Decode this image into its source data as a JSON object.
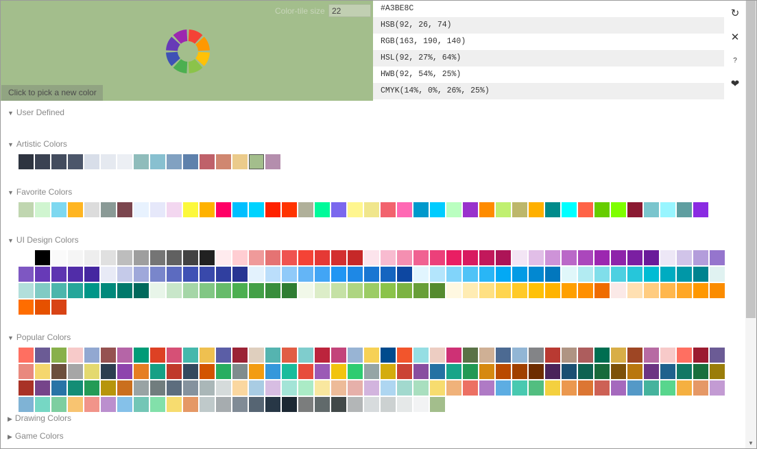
{
  "current_color": "#A3BE8C",
  "preview": {
    "tile_size_label": "Color-tile size",
    "tile_size_value": "22",
    "pick_button": "Click to pick a new color",
    "wheel_colors": [
      "#f44336",
      "#ff9800",
      "#ffc107",
      "#8bc34a",
      "#4caf50",
      "#3f51b5",
      "#673ab7",
      "#9c27b0"
    ]
  },
  "formats": [
    "#A3BE8C",
    "HSB(92, 26, 74)",
    "RGB(163, 190, 140)",
    "HSL(92, 27%, 64%)",
    "HWB(92, 54%, 25%)",
    "CMYK(14%, 0%, 26%, 25%)"
  ],
  "tools": [
    {
      "name": "refresh-icon",
      "glyph": "↻"
    },
    {
      "name": "close-icon",
      "glyph": "✕"
    },
    {
      "name": "help-icon",
      "glyph": "?"
    },
    {
      "name": "heart-icon",
      "glyph": "❤"
    }
  ],
  "sections": [
    {
      "id": "user-defined",
      "title": "User Defined",
      "expanded": true,
      "colors": []
    },
    {
      "id": "artistic",
      "title": "Artistic Colors",
      "expanded": true,
      "selected_index": 14,
      "colors": [
        "#2E3440",
        "#3B4252",
        "#434C5E",
        "#4C566A",
        "#D8DEE9",
        "#E5E9F0",
        "#ECEFF4",
        "#8FBCBB",
        "#88C0D0",
        "#81A1C1",
        "#5E81AC",
        "#BF616A",
        "#D08770",
        "#EBCB8B",
        "#A3BE8C",
        "#B48EAD"
      ]
    },
    {
      "id": "favorite",
      "title": "Favorite Colors",
      "expanded": true,
      "colors": [
        "#C0D6B0",
        "#D0F5D0",
        "#7ED8F0",
        "#FFB521",
        "#DCDCDC",
        "#8A9A96",
        "#7B464E",
        "#E8F2FE",
        "#E6E8FA",
        "#F3D7F0",
        "#FCF83C",
        "#FFB200",
        "#FF0066",
        "#00BFFF",
        "#00D3FF",
        "#FF2200",
        "#FF3300",
        "#B0B09A",
        "#00FA9A",
        "#7B68EE",
        "#FFF68F",
        "#F0E68C",
        "#F2636E",
        "#FF69B4",
        "#0099CC",
        "#00CCFF",
        "#BAFFC0",
        "#9932CC",
        "#FF8C00",
        "#C0F070",
        "#BDB76B",
        "#FFB000",
        "#008B8B",
        "#00FFFF",
        "#FF6347",
        "#66CD00",
        "#7FFF00",
        "#8B1A32",
        "#7AC5CD",
        "#98F5FF",
        "#5F9EA0",
        "#8A2BE2"
      ]
    },
    {
      "id": "ui-design",
      "title": "UI Design Colors",
      "expanded": true,
      "colors": [
        "#FFFFFF",
        "#000000",
        "#FAFAFA",
        "#F5F5F5",
        "#EEEEEE",
        "#E0E0E0",
        "#BDBDBD",
        "#9E9E9E",
        "#757575",
        "#616161",
        "#424242",
        "#212121",
        "#FFEBEE",
        "#FFCDD2",
        "#EF9A9A",
        "#E57373",
        "#EF5350",
        "#F44336",
        "#E53935",
        "#D32F2F",
        "#C62828",
        "#FCE4EC",
        "#F8BBD0",
        "#F48FB1",
        "#F06292",
        "#EC407A",
        "#E91E63",
        "#D81B60",
        "#C2185B",
        "#AD1457",
        "#F3E5F5",
        "#E1BEE7",
        "#CE93D8",
        "#BA68C8",
        "#AB47BC",
        "#9C27B0",
        "#8E24AA",
        "#7B1FA2",
        "#6A1B9A",
        "#EDE7F6",
        "#D1C4E9",
        "#B39DDB",
        "#9575CD",
        "#7E57C2",
        "#673AB7",
        "#5E35B1",
        "#512DA8",
        "#4527A0",
        "#E8EAF6",
        "#C5CAE9",
        "#9FA8DA",
        "#7986CB",
        "#5C6BC0",
        "#3F51B5",
        "#3949AB",
        "#303F9F",
        "#283593",
        "#E3F2FD",
        "#BBDEFB",
        "#90CAF9",
        "#64B5F6",
        "#42A5F5",
        "#2196F3",
        "#1E88E5",
        "#1976D2",
        "#1565C0",
        "#0D47A1",
        "#E1F5FE",
        "#B3E5FC",
        "#81D4FA",
        "#4FC3F7",
        "#29B6F6",
        "#03A9F4",
        "#039BE5",
        "#0288D1",
        "#0277BD",
        "#E0F7FA",
        "#B2EBF2",
        "#80DEEA",
        "#4DD0E1",
        "#26C6DA",
        "#00BCD4",
        "#00ACC1",
        "#0097A7",
        "#00838F",
        "#E0F2F1",
        "#B2DFDB",
        "#80CBC4",
        "#4DB6AC",
        "#26A69A",
        "#009688",
        "#00897B",
        "#00796B",
        "#00695C",
        "#E8F5E9",
        "#C8E6C9",
        "#A5D6A7",
        "#81C784",
        "#66BB6A",
        "#4CAF50",
        "#43A047",
        "#388E3C",
        "#2E7D32",
        "#F1F8E9",
        "#DCEDC8",
        "#C5E1A5",
        "#AED581",
        "#9CCC65",
        "#8BC34A",
        "#7CB342",
        "#689F38",
        "#558B2F",
        "#FFF8E1",
        "#FFECB3",
        "#FFE082",
        "#FFD54F",
        "#FFCA28",
        "#FFC107",
        "#FFB300",
        "#FFA000",
        "#FF8F00",
        "#EF6C00",
        "#FBE9E7",
        "#FFE0B2",
        "#FFCC80",
        "#FFB74D",
        "#FFA726",
        "#FF9800",
        "#FB8C00",
        "#FF6D00",
        "#E65100",
        "#D84315"
      ]
    },
    {
      "id": "popular",
      "title": "Popular Colors",
      "expanded": true,
      "colors": [
        "#FF6F61",
        "#6B5B95",
        "#88B04B",
        "#F7CAC9",
        "#92A8D1",
        "#955251",
        "#B565A7",
        "#009B77",
        "#DD4124",
        "#D65076",
        "#45B8AC",
        "#EFC050",
        "#5B5EA6",
        "#9B2335",
        "#DFCFBE",
        "#55B4B0",
        "#E15D44",
        "#7FCDCD",
        "#BC243C",
        "#C3447A",
        "#98B4D4",
        "#F6D155",
        "#004B8D",
        "#F2552C",
        "#95DEE3",
        "#EDCDC2",
        "#CE3175",
        "#5A7247",
        "#CFB095",
        "#4C6A92",
        "#92B6D5",
        "#838487",
        "#B93A32",
        "#AF9483",
        "#AD5D5D",
        "#006E51",
        "#D8AE47",
        "#9E4624",
        "#B76BA3",
        "#F7CAC9",
        "#FF6F61",
        "#9B1B30",
        "#6B5B95",
        "#E9897E",
        "#F5D76E",
        "#6C4F3D",
        "#A6A6A6",
        "#E4D96F",
        "#2C3E50",
        "#8E44AD",
        "#E67E22",
        "#16A085",
        "#C0392B",
        "#34495E",
        "#D35400",
        "#27AE60",
        "#7F8C8D",
        "#F39C12",
        "#3498DB",
        "#1ABC9C",
        "#E74C3C",
        "#9B59B6",
        "#F1C40F",
        "#2ECC71",
        "#95A5A6",
        "#D4AC0D",
        "#CB4335",
        "#884EA0",
        "#2471A3",
        "#17A589",
        "#229954",
        "#D68910",
        "#BA4A00",
        "#A04000",
        "#6E2C00",
        "#4A235A",
        "#1B4F72",
        "#0E6251",
        "#186A3B",
        "#7E5109",
        "#B9770E",
        "#6C3483",
        "#1F618D",
        "#117864",
        "#196F3D",
        "#9A7D0A",
        "#A93226",
        "#76448A",
        "#2874A6",
        "#138D75",
        "#239B56",
        "#B7950B",
        "#CA6F1E",
        "#99A3A4",
        "#717D7E",
        "#5D6D7E",
        "#85929E",
        "#AAB7B8",
        "#D5DBDB",
        "#FAD7A0",
        "#A9CCE3",
        "#D7BDE2",
        "#A3E4D7",
        "#ABEBC6",
        "#F9E79F",
        "#EDBB99",
        "#E6B0AA",
        "#D2B4DE",
        "#AED6F1",
        "#A2D9CE",
        "#A9DFBF",
        "#F7DC6F",
        "#F0B27A",
        "#EC7063",
        "#AF7AC5",
        "#5DADE2",
        "#48C9B0",
        "#52BE80",
        "#F4D03F",
        "#EB984E",
        "#DC7633",
        "#CD6155",
        "#A569BD",
        "#5499C7",
        "#45B39D",
        "#58D68D",
        "#F5B041",
        "#E59866",
        "#C39BD3",
        "#7FB3D5",
        "#76D7C4",
        "#7DCEA0",
        "#F8C471",
        "#F1948A",
        "#BB8FCE",
        "#85C1E9",
        "#73C6B6",
        "#82E0AA",
        "#F7DC6F",
        "#E59866",
        "#BFC9CA",
        "#A6ACAF",
        "#808B96",
        "#566573",
        "#273746",
        "#1C2833",
        "#7B7D7D",
        "#616A6B",
        "#424949",
        "#B3B6B7",
        "#D7DBDD",
        "#CCD1D1",
        "#E5E8E8",
        "#F2F3F4",
        "#A3BE8C"
      ]
    },
    {
      "id": "drawing",
      "title": "Drawing Colors",
      "expanded": false,
      "colors": []
    },
    {
      "id": "game",
      "title": "Game Colors",
      "expanded": false,
      "colors": []
    }
  ]
}
